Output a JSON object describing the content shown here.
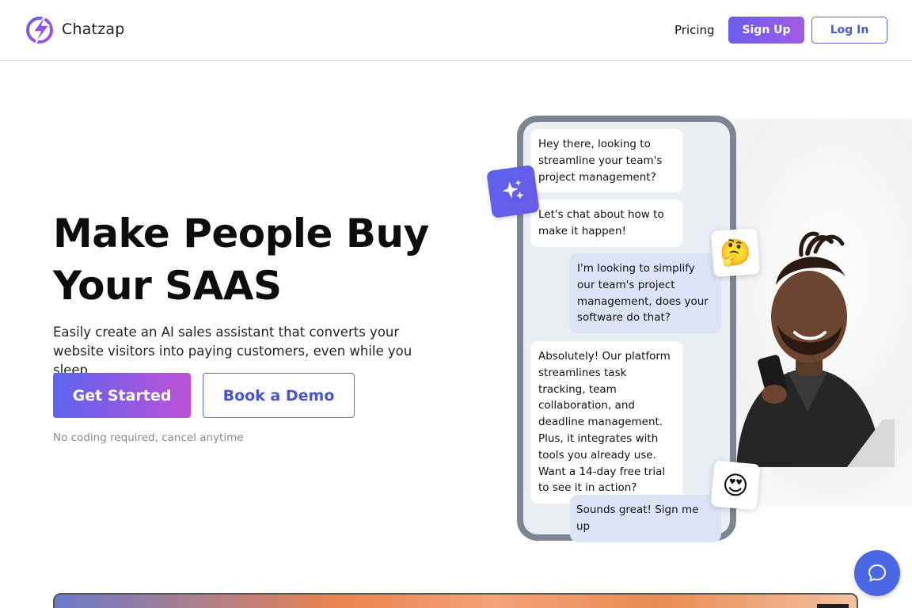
{
  "header": {
    "brand": "Chatzap",
    "nav_pricing": "Pricing",
    "signup_label": "Sign Up",
    "login_label": "Log In"
  },
  "hero": {
    "title_line1": "Make People Buy",
    "title_line2": "Your SAAS",
    "subtitle": "Easily create an AI sales assistant that converts your website visitors into paying customers, even while you sleep",
    "cta_primary": "Get Started",
    "cta_secondary": "Book a Demo",
    "note": "No coding required, cancel anytime"
  },
  "chat": {
    "messages": [
      {
        "from": "bot",
        "text": "Hey there, looking to streamline your team's project management?"
      },
      {
        "from": "bot",
        "text": "Let's chat about how to make it happen!"
      },
      {
        "from": "user",
        "text": "I'm looking to simplify our team's project management, does your software do that?"
      },
      {
        "from": "bot",
        "text": "Absolutely! Our platform streamlines task tracking, team collaboration, and deadline management. Plus, it integrates with tools you already use. Want a 14-day free trial to see it in action?"
      },
      {
        "from": "user",
        "text": "Sounds great! Sign me up"
      }
    ],
    "emoji_thinking": "🤔",
    "emoji_hearts": "😍"
  },
  "colors": {
    "accent": "#5d63ef",
    "accent_end": "#bd52d8",
    "outline": "#4a5bd2",
    "chat_widget": "#4b67e6"
  },
  "icons": [
    "chatzap-logo-icon",
    "sparkle-icon",
    "chat-bubble-icon"
  ]
}
